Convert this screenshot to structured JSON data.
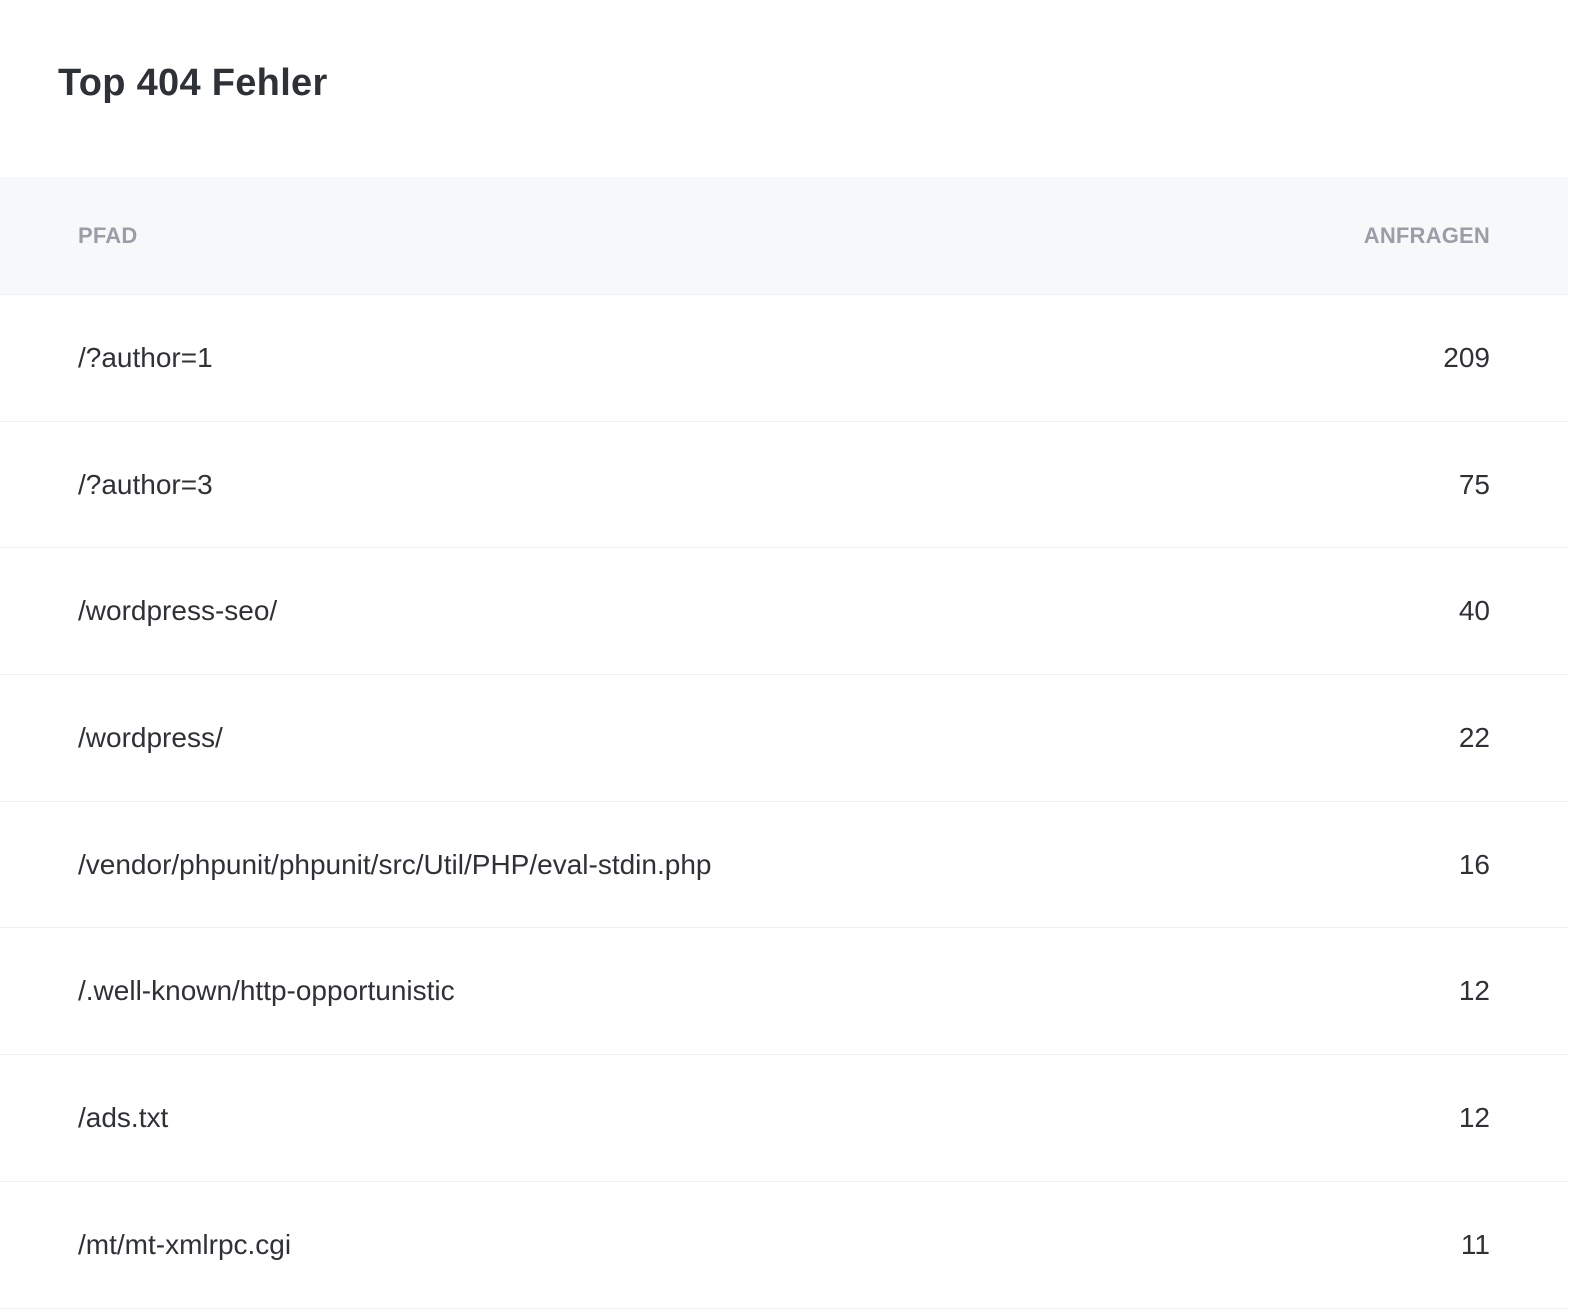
{
  "title": "Top 404 Fehler",
  "table": {
    "headers": {
      "path": "PFAD",
      "requests": "ANFRAGEN"
    },
    "rows": [
      {
        "path": "/?author=1",
        "requests": "209"
      },
      {
        "path": "/?author=3",
        "requests": "75"
      },
      {
        "path": "/wordpress-seo/",
        "requests": "40"
      },
      {
        "path": "/wordpress/",
        "requests": "22"
      },
      {
        "path": "/vendor/phpunit/phpunit/src/Util/PHP/eval-stdin.php",
        "requests": "16"
      },
      {
        "path": "/.well-known/http-opportunistic",
        "requests": "12"
      },
      {
        "path": "/ads.txt",
        "requests": "12"
      },
      {
        "path": "/mt/mt-xmlrpc.cgi",
        "requests": "11"
      }
    ]
  }
}
